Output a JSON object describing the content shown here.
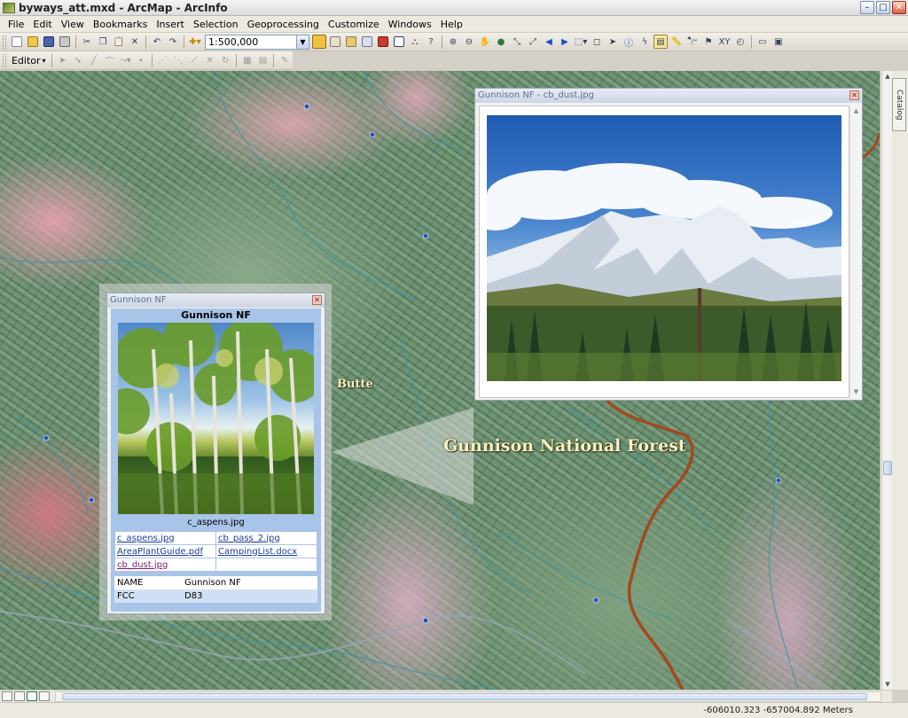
{
  "window": {
    "title": "byways_att.mxd - ArcMap - ArcInfo"
  },
  "menu": [
    "File",
    "Edit",
    "View",
    "Bookmarks",
    "Insert",
    "Selection",
    "Geoprocessing",
    "Customize",
    "Windows",
    "Help"
  ],
  "toolbar": {
    "scale": "1:500,000",
    "editor_label": "Editor"
  },
  "map": {
    "label_butte": "Butte",
    "label_forest": "Gunnison National Forest"
  },
  "identify_popup": {
    "window_title": "Gunnison NF",
    "heading": "Gunnison NF",
    "photo_caption": "c_aspens.jpg",
    "attachments": [
      [
        "c_aspens.jpg",
        "cb_pass_2.jpg"
      ],
      [
        "AreaPlantGuide.pdf",
        "CampingList.docx"
      ],
      [
        "cb_dust.jpg",
        ""
      ]
    ],
    "fields": [
      {
        "name": "NAME",
        "value": "Gunnison NF"
      },
      {
        "name": "FCC",
        "value": "D83"
      }
    ]
  },
  "photo_window": {
    "title": "Gunnison NF - cb_dust.jpg"
  },
  "side_panel": {
    "catalog_tab": "Catalog"
  },
  "status": {
    "coordinates": "-606010.323  -657004.892 Meters"
  }
}
